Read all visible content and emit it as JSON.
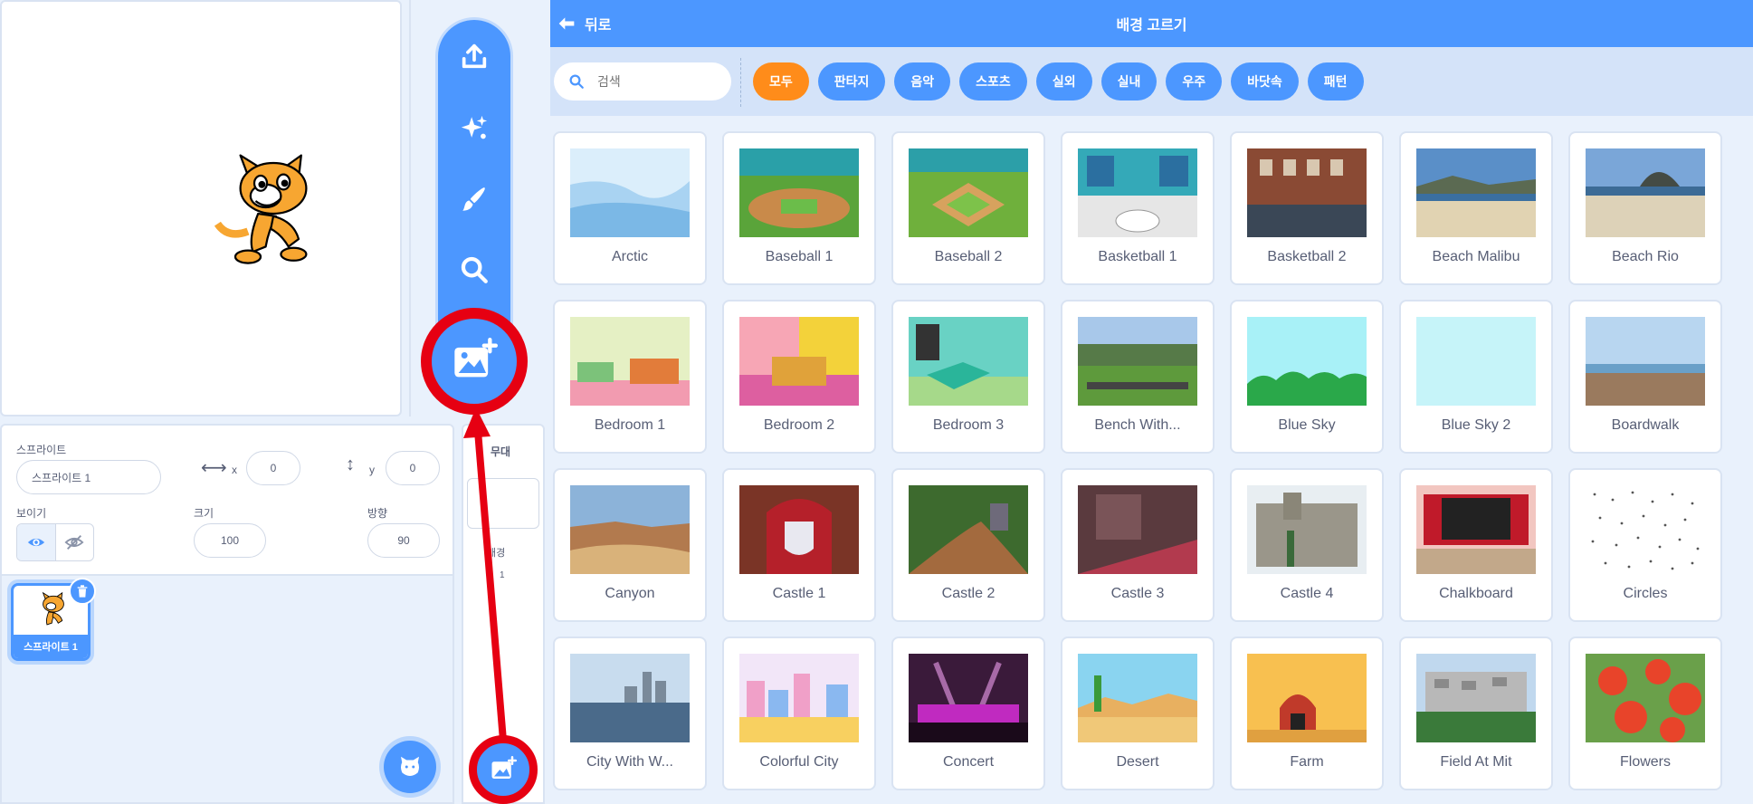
{
  "popup_menu": {
    "items": [
      {
        "name": "upload-backdrop-icon"
      },
      {
        "name": "surprise-icon"
      },
      {
        "name": "paint-icon"
      },
      {
        "name": "search-icon"
      }
    ]
  },
  "sprite_info": {
    "sprite_label": "스프라이트",
    "sprite_name": "스프라이트 1",
    "x_label": "x",
    "x_value": "0",
    "y_label": "y",
    "y_value": "0",
    "show_label": "보이기",
    "size_label": "크기",
    "size_value": "100",
    "direction_label": "방향",
    "direction_value": "90"
  },
  "sprite_list": {
    "sprites": [
      {
        "name": "스프라이트 1"
      }
    ]
  },
  "stage_pane": {
    "title": "무대",
    "backdrops_label": "배경",
    "backdrops_count": "1"
  },
  "library": {
    "back_label": "뒤로",
    "title": "배경 고르기",
    "search_placeholder": "검색",
    "tags": [
      "모두",
      "판타지",
      "음악",
      "스포츠",
      "실외",
      "실내",
      "우주",
      "바닷속",
      "패턴"
    ],
    "active_tag": "모두",
    "backdrops": [
      "Arctic",
      "Baseball 1",
      "Baseball 2",
      "Basketball 1",
      "Basketball 2",
      "Beach Malibu",
      "Beach Rio",
      "Bedroom 1",
      "Bedroom 2",
      "Bedroom 3",
      "Bench With...",
      "Blue Sky",
      "Blue Sky 2",
      "Boardwalk",
      "Canyon",
      "Castle 1",
      "Castle 2",
      "Castle 3",
      "Castle 4",
      "Chalkboard",
      "Circles",
      "City With W...",
      "Colorful City",
      "Concert",
      "Desert",
      "Farm",
      "Field At Mit",
      "Flowers"
    ]
  },
  "colors": {
    "scratch_blue": "#4c97ff",
    "active_tag": "#ff8c1a",
    "highlight_red": "#e60012",
    "text_gray": "#575e75",
    "bg_light": "#e9f1fc"
  }
}
